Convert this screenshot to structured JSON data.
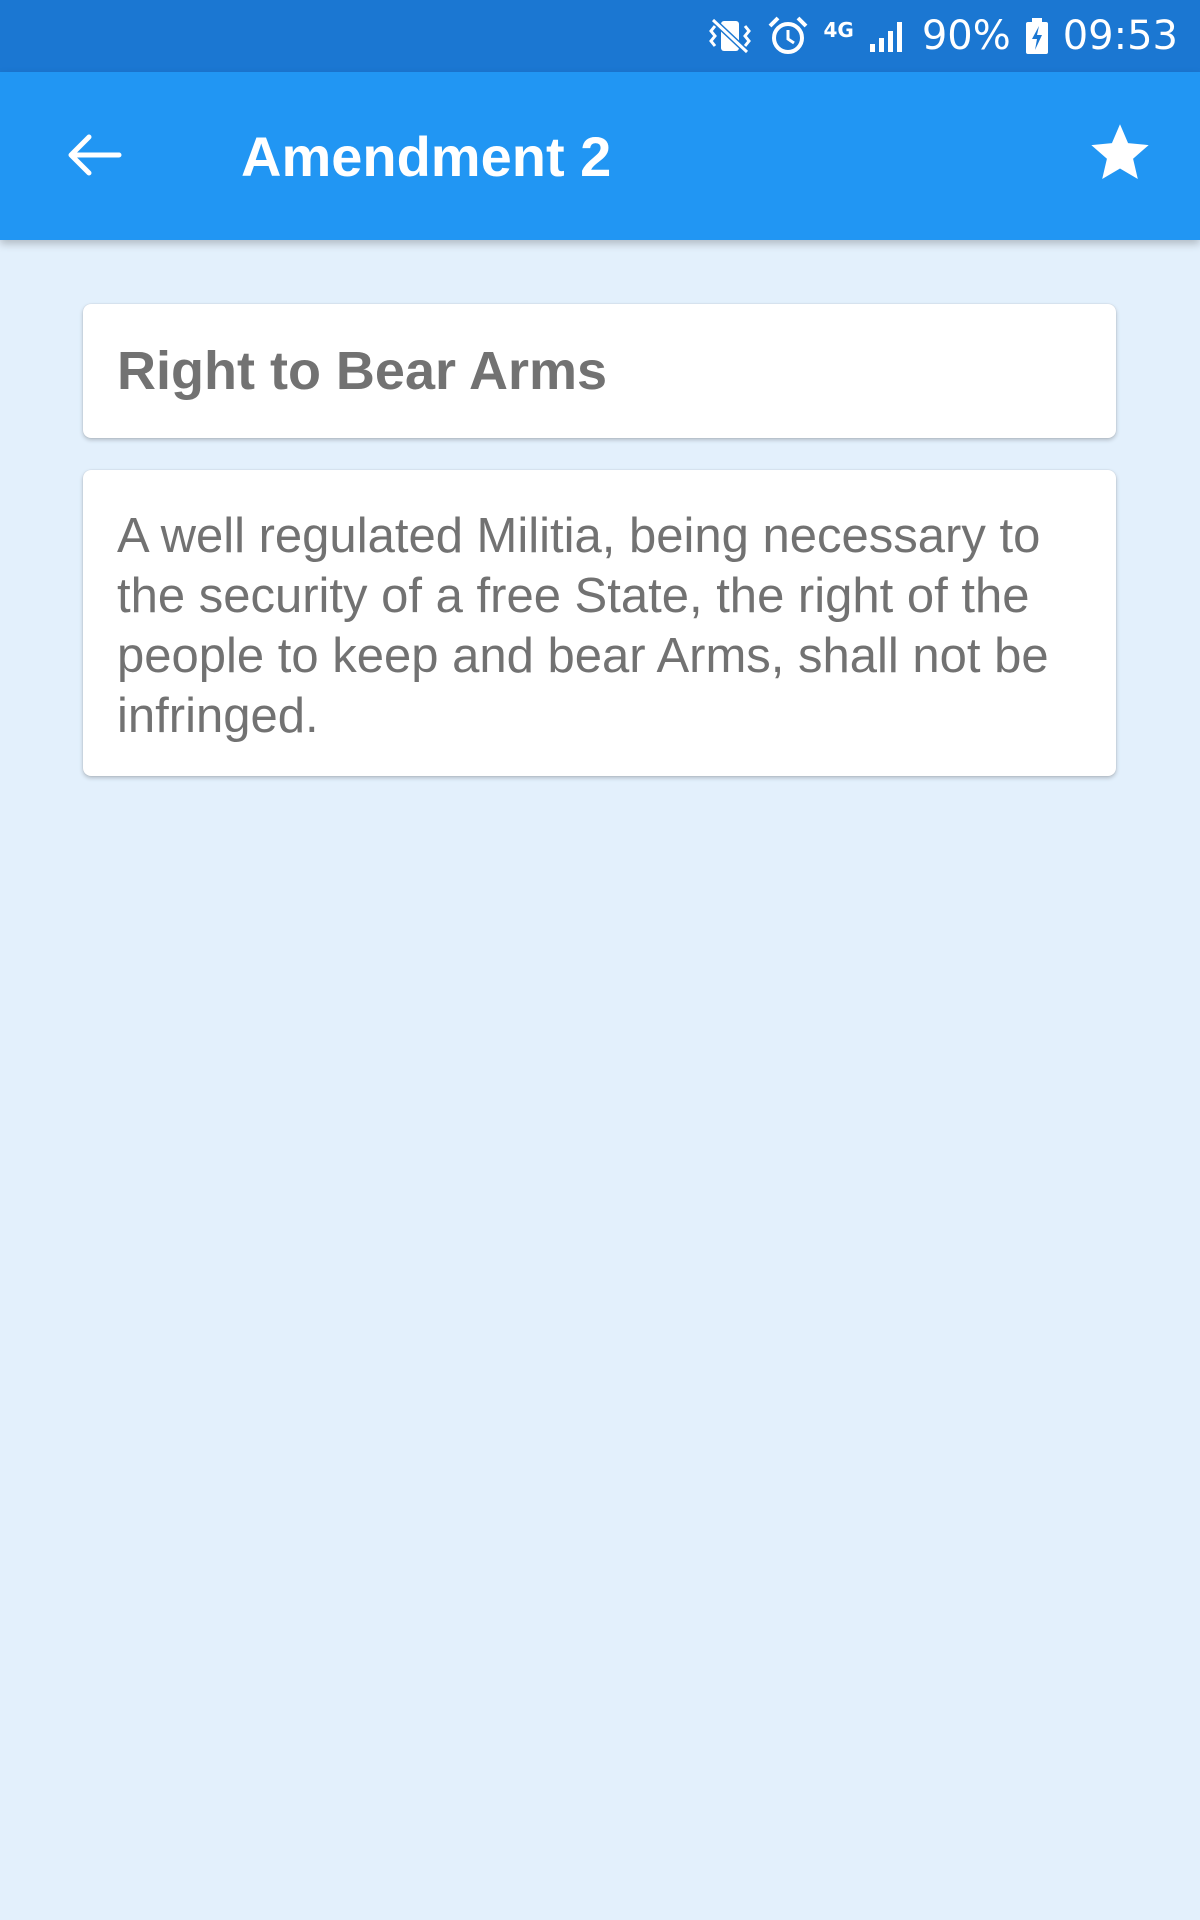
{
  "status_bar": {
    "network_type": "4G",
    "battery": "90%",
    "time": "09:53",
    "icons": [
      "vibrate-icon",
      "alarm-icon",
      "network-4g-icon",
      "signal-icon",
      "battery-charging-icon"
    ]
  },
  "app_bar": {
    "title": "Amendment 2",
    "back_icon": "arrow-left-icon",
    "favorite_icon": "star-icon"
  },
  "content": {
    "heading": "Right to Bear Arms",
    "text": "A well regulated Militia, being necessary to the security of a free State, the right of the people to keep and bear Arms, shall not be infringed."
  },
  "colors": {
    "status_bar": "#1b77d2",
    "app_bar": "#2196f3",
    "background": "#e3f0fc",
    "card": "#ffffff",
    "text": "#727272"
  }
}
